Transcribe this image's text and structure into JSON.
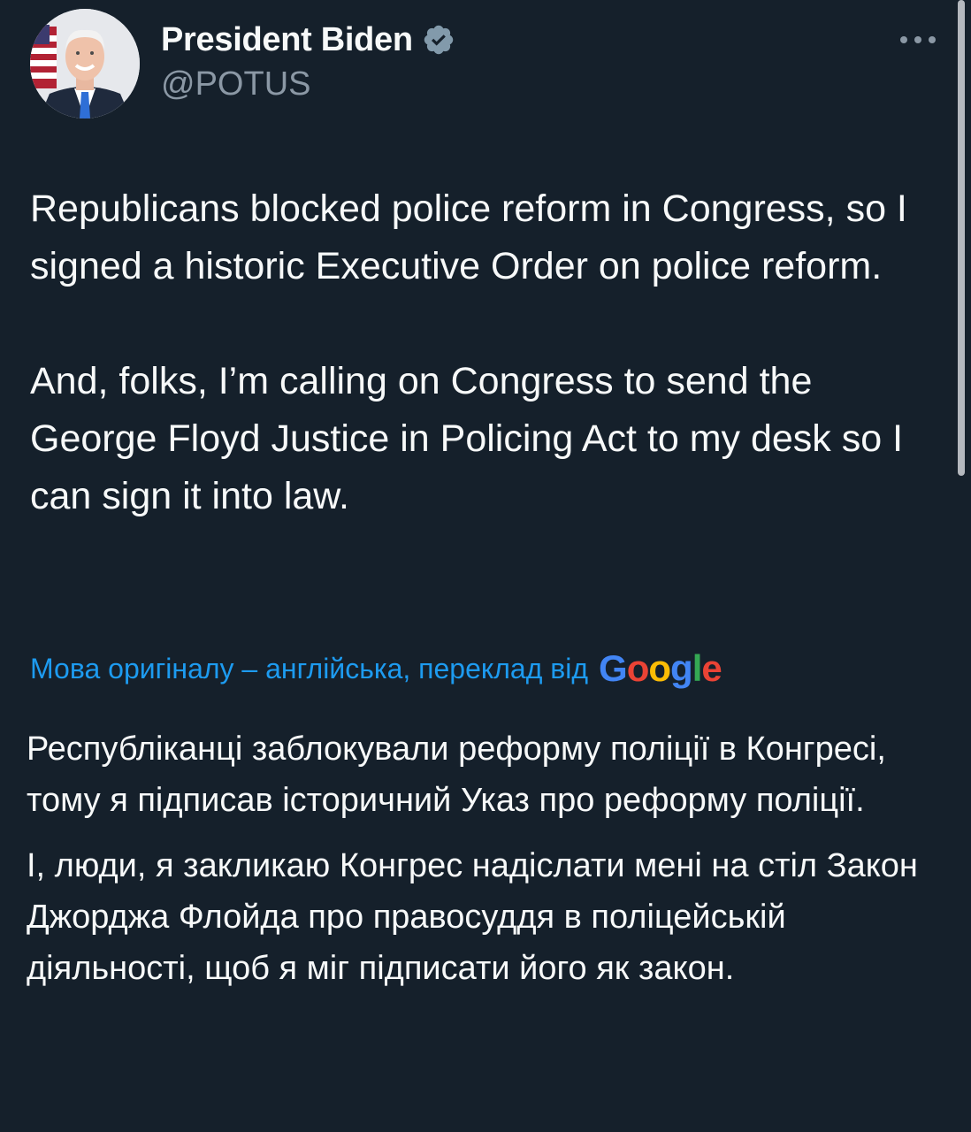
{
  "author": {
    "display_name": "President Biden",
    "handle": "@POTUS",
    "verified_icon": "verified-badge-icon",
    "avatar": "profile-photo"
  },
  "menu": {
    "more_icon": "more-options-icon"
  },
  "tweet": {
    "paragraphs": [
      "Republicans blocked police reform in Congress, so I signed a historic Executive Order on police reform.",
      "And, folks, I’m calling on Congress to send the George Floyd Justice in Policing Act to my desk so I can sign it into law."
    ]
  },
  "translation": {
    "link_text": "Мова оригіналу – англійська, переклад від",
    "provider": "Google",
    "paragraphs": [
      "Республіканці заблокували реформу поліції в Конгресі, тому я підписав історичний Указ про реформу поліції.",
      "І, люди, я закликаю Конгрес надіслати мені на стіл Закон Джорджа Флойда про правосуддя в поліцейській діяльності, щоб я міг підписати його як закон."
    ]
  },
  "colors": {
    "background": "#15202b",
    "text": "#f7f9f9",
    "secondary_text": "#8b98a5",
    "link": "#1d9bf0"
  }
}
